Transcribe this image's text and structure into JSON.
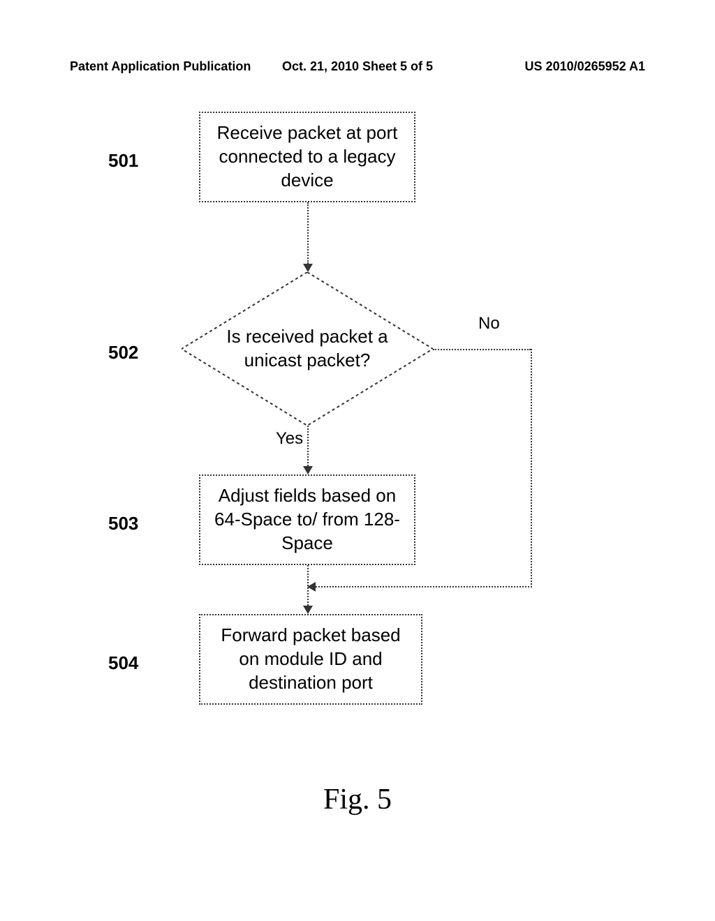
{
  "header": {
    "left": "Patent Application Publication",
    "center": "Oct. 21, 2010  Sheet 5 of 5",
    "right": "US 2010/0265952 A1"
  },
  "steps": {
    "s501": {
      "label": "501",
      "text": "Receive packet at port connected to a legacy device"
    },
    "s502": {
      "label": "502",
      "text": "Is received packet a unicast packet?",
      "yes": "Yes",
      "no": "No"
    },
    "s503": {
      "label": "503",
      "text": "Adjust fields based on 64-Space to/ from 128-Space"
    },
    "s504": {
      "label": "504",
      "text": "Forward packet based on module ID and destination port"
    }
  },
  "figure": "Fig. 5"
}
